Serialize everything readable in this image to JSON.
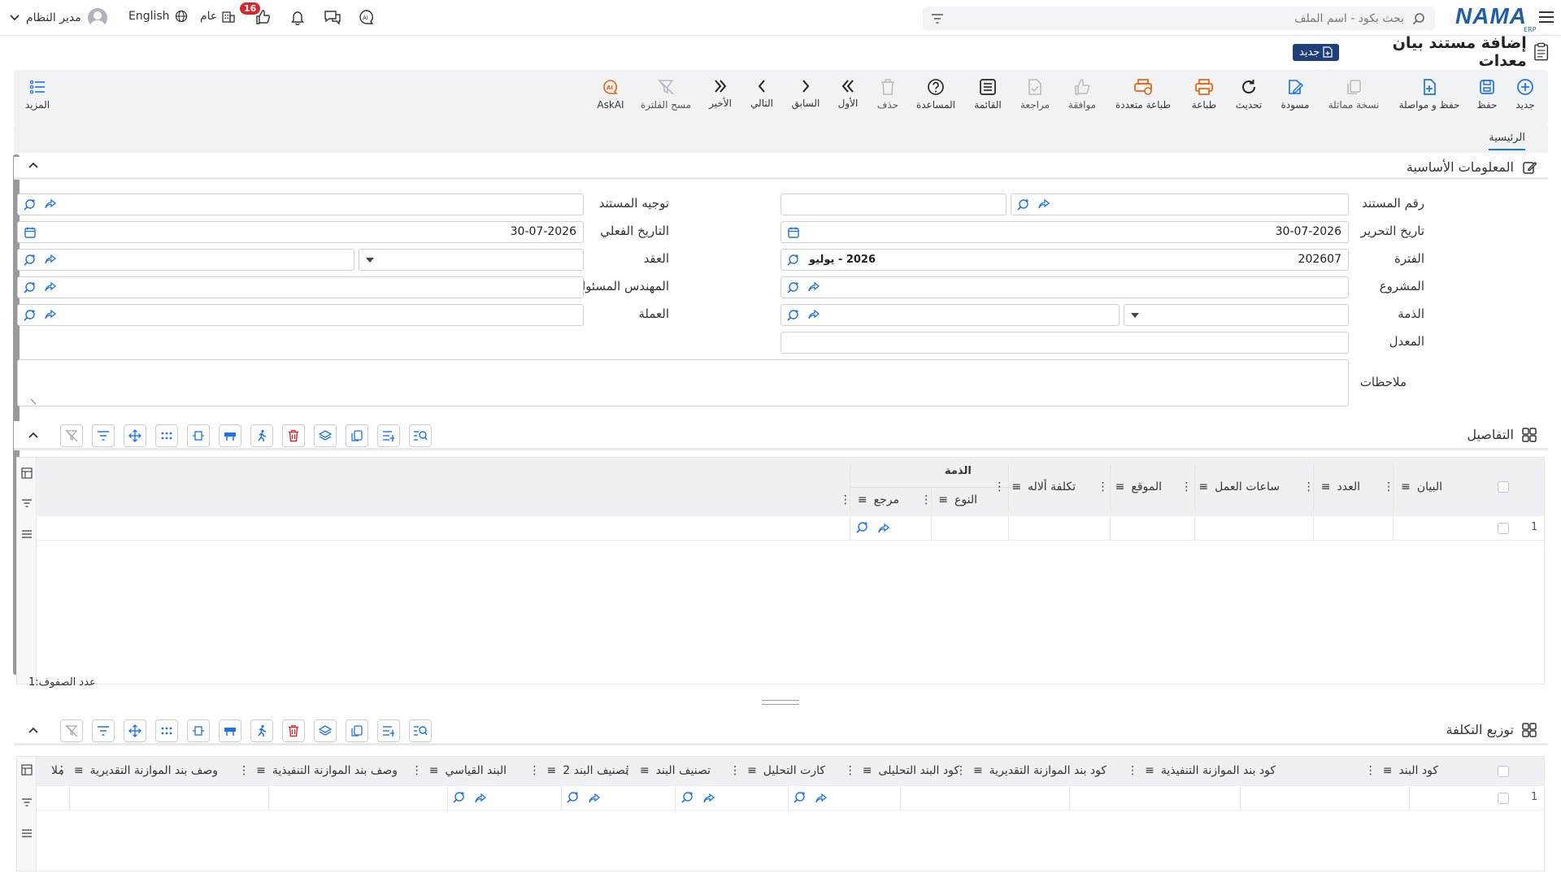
{
  "topbar": {
    "search_placeholder": "بحث بكود - اسم الملف",
    "logo_text": "NAMA",
    "logo_sub": "ERP",
    "user_name": "مدير النظام",
    "language": "English",
    "scope": "عام",
    "notifications_count": "16"
  },
  "page": {
    "title": "إضافة مستند بيان معدات",
    "status_badge": "جديد"
  },
  "toolbar": {
    "items": [
      {
        "label": "جديد",
        "icon": "plus-circle-icon"
      },
      {
        "label": "حفظ",
        "icon": "save-icon"
      },
      {
        "label": "حفظ و مواصلة",
        "icon": "save-continue-icon"
      },
      {
        "label": "نسخة مماثلة",
        "icon": "copy-icon"
      },
      {
        "label": "مسودة",
        "icon": "draft-icon"
      },
      {
        "label": "تحديث",
        "icon": "refresh-icon"
      },
      {
        "label": "طباعة",
        "icon": "print-icon"
      },
      {
        "label": "طباعة متعددة",
        "icon": "multi-print-icon"
      },
      {
        "label": "موافقة",
        "icon": "thumbs-up-icon"
      },
      {
        "label": "مراجعة",
        "icon": "review-icon"
      },
      {
        "label": "القائمة",
        "icon": "list-icon"
      },
      {
        "label": "المساعدة",
        "icon": "help-icon"
      },
      {
        "label": "حذف",
        "icon": "trash-icon"
      },
      {
        "label": "الأول",
        "icon": "first-icon"
      },
      {
        "label": "السابق",
        "icon": "previous-icon"
      },
      {
        "label": "التالي",
        "icon": "next-icon"
      },
      {
        "label": "الأخير",
        "icon": "last-icon"
      },
      {
        "label": "مسح الفلترة",
        "icon": "clear-filter-icon"
      },
      {
        "label": "AskAI",
        "icon": "ask-ai-icon"
      }
    ],
    "more_label": "المزيد"
  },
  "tabs": {
    "main": "الرئيسية"
  },
  "basic_info": {
    "title": "المعلومات الأساسية",
    "fields": {
      "doc_number": {
        "label": "رقم المستند",
        "value": ""
      },
      "doc_direction": {
        "label": "توجيه المستند",
        "value": ""
      },
      "edit_date": {
        "label": "تاريخ التحرير",
        "value": "30-07-2026"
      },
      "actual_date": {
        "label": "التاريخ الفعلي",
        "value": "30-07-2026"
      },
      "period": {
        "label": "الفترة",
        "value": "202607",
        "desc": "2026 - يوليو"
      },
      "contract": {
        "label": "العقد",
        "value": ""
      },
      "project": {
        "label": "المشروع",
        "value": ""
      },
      "engineer": {
        "label": "المهندس المسئول",
        "value": ""
      },
      "account": {
        "label": "الذمة",
        "value": ""
      },
      "currency": {
        "label": "العملة",
        "value": ""
      },
      "rate": {
        "label": "المعدل",
        "value": ""
      },
      "notes": {
        "label": "ملاحظات",
        "value": ""
      }
    }
  },
  "details": {
    "title": "التفاصيل",
    "group_header": "الذمة",
    "columns": [
      "البيان",
      "العدد",
      "ساعات العمل",
      "الموقع",
      "تكلفة ألاله",
      "النوع",
      "مرجع"
    ],
    "rows": [
      {
        "num": "1"
      }
    ],
    "row_count_label": "عدد الصفوف:",
    "row_count": "1"
  },
  "cost_distribution": {
    "title": "توزيع التكلفة",
    "columns": [
      "كود البند",
      "كود بند الموازنة التنفيذية",
      "كود بند الموازنة التقديرية",
      "كود البند التحليلى",
      "كارت التحليل",
      "تصنيف البند",
      "تصنيف البند 2",
      "البند القياسي",
      "وصف بند الموازنة التنفيذية",
      "وصف بند الموازنة التقديرية",
      "ملا"
    ],
    "rows": [
      {
        "num": "1"
      }
    ]
  },
  "colors": {
    "accent": "#1a73e8",
    "brand": "#1f3f7a",
    "print_orange": "#e8620f",
    "badge_red": "#d9262c"
  }
}
